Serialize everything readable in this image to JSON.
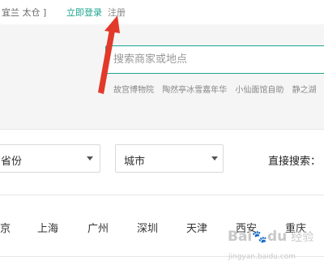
{
  "topbar": {
    "city_text": "宜兰  太仓 ]",
    "login": "立即登录",
    "register": "注册"
  },
  "search": {
    "placeholder": "搜索商家或地点",
    "hot": [
      "故宫博物院",
      "陶然亭冰雪嘉年华",
      "小仙面馆自助",
      "静之湖"
    ]
  },
  "filters": {
    "province": "省份",
    "city": "城市",
    "direct_search": "直接搜索："
  },
  "cities": [
    "京",
    "上海",
    "广州",
    "深圳",
    "天津",
    "西安",
    "重庆"
  ],
  "watermark": {
    "brand": "Bai",
    "brand2": "du",
    "word": "经验",
    "url": "jingyan.baidu.com"
  },
  "colors": {
    "accent": "#1da58f",
    "annotation_arrow": "#e23a2a"
  }
}
